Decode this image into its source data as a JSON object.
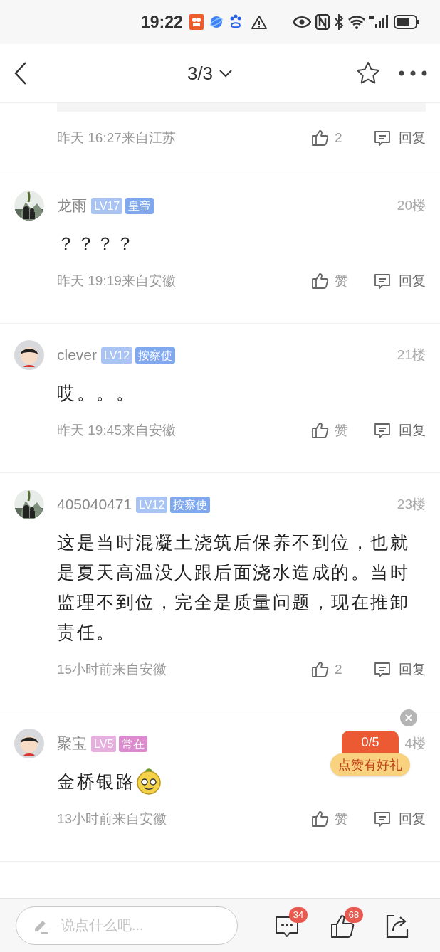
{
  "status_bar": {
    "time": "19:22"
  },
  "header": {
    "page_indicator": "3/3"
  },
  "partial_comment": {
    "time": "昨天 16:27来自江苏",
    "likes": "2",
    "reply": "回复"
  },
  "comments": [
    {
      "name": "龙雨",
      "badges": [
        {
          "text": "LV17",
          "color": "#a9c4f2"
        },
        {
          "text": "皇帝",
          "color": "#7fa8ee"
        }
      ],
      "floor": "20楼",
      "text": "？？？？",
      "sticker": false,
      "time": "昨天 19:19来自安徽",
      "likes": "赞",
      "reply": "回复"
    },
    {
      "name": "clever",
      "avatar": {
        "kind": "icon"
      },
      "badges": [
        {
          "text": "LV12",
          "color": "#a9c4f2"
        },
        {
          "text": "按察使",
          "color": "#7fa8ee"
        }
      ],
      "floor": "21楼",
      "text": "哎。。。",
      "sticker": false,
      "time": "昨天 19:45来自安徽",
      "likes": "赞",
      "reply": "回复"
    },
    {
      "name": "405040471",
      "badges": [
        {
          "text": "LV12",
          "color": "#a9c4f2"
        },
        {
          "text": "按察使",
          "color": "#7fa8ee"
        }
      ],
      "floor": "23楼",
      "text": "这是当时混凝土浇筑后保养不到位，也就是夏天高温没人跟后面浇水造成的。当时监理不到位，完全是质量问题，现在推卸责任。",
      "sticker": false,
      "time": "15小时前来自安徽",
      "likes": "2",
      "reply": "回复"
    },
    {
      "name": "聚宝",
      "avatar": {
        "kind": "icon"
      },
      "badges": [
        {
          "text": "LV5",
          "color": "#e6b0de"
        },
        {
          "text": "常在",
          "color": "#db8ccf"
        }
      ],
      "floor": "4楼",
      "text": "金桥银路",
      "sticker": true,
      "time": "13小时前来自安徽",
      "likes": "赞",
      "reply": "回复"
    }
  ],
  "gift_popup": {
    "progress": "0/5",
    "label": "点赞有好礼"
  },
  "bottom_bar": {
    "placeholder": "说点什么吧...",
    "comment_count": "34",
    "like_count": "68"
  }
}
